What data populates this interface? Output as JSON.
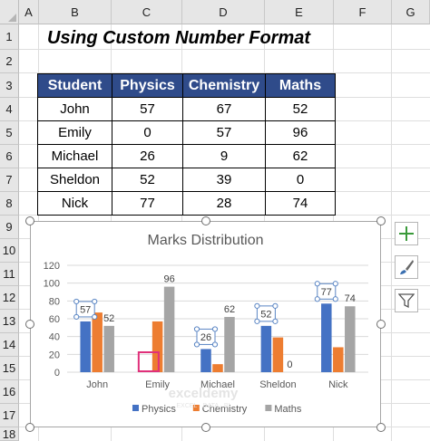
{
  "columns": [
    "A",
    "B",
    "C",
    "D",
    "E",
    "F",
    "G"
  ],
  "rows": [
    "1",
    "2",
    "3",
    "4",
    "5",
    "6",
    "7",
    "8",
    "9",
    "10",
    "11",
    "12",
    "13",
    "14",
    "15",
    "16",
    "17",
    "18"
  ],
  "sheet_title": "Using Custom Number Format",
  "table": {
    "headers": [
      "Student",
      "Physics",
      "Chemistry",
      "Maths"
    ],
    "rows": [
      [
        "John",
        "57",
        "67",
        "52"
      ],
      [
        "Emily",
        "0",
        "57",
        "96"
      ],
      [
        "Michael",
        "26",
        "9",
        "62"
      ],
      [
        "Sheldon",
        "52",
        "39",
        "0"
      ],
      [
        "Nick",
        "77",
        "28",
        "74"
      ]
    ]
  },
  "chart_data": {
    "type": "bar",
    "title": "Marks Distribution",
    "categories": [
      "John",
      "Emily",
      "Michael",
      "Sheldon",
      "Nick"
    ],
    "series": [
      {
        "name": "Physics",
        "values": [
          57,
          0,
          26,
          52,
          77
        ],
        "color": "#4472c4"
      },
      {
        "name": "Chemistry",
        "values": [
          67,
          57,
          9,
          39,
          28
        ],
        "color": "#ed7d31"
      },
      {
        "name": "Maths",
        "values": [
          52,
          96,
          62,
          0,
          74
        ],
        "color": "#a5a5a5"
      }
    ],
    "data_labels": [
      {
        "series": "Physics",
        "category": "John",
        "text": "57",
        "selected": true
      },
      {
        "series": "Physics",
        "category": "Michael",
        "text": "26",
        "selected": true
      },
      {
        "series": "Physics",
        "category": "Sheldon",
        "text": "52",
        "selected": true
      },
      {
        "series": "Physics",
        "category": "Nick",
        "text": "77",
        "selected": true
      },
      {
        "series": "Maths",
        "category": "John",
        "text": "52",
        "selected": false
      },
      {
        "series": "Maths",
        "category": "Emily",
        "text": "96",
        "selected": false
      },
      {
        "series": "Maths",
        "category": "Michael",
        "text": "62",
        "selected": false
      },
      {
        "series": "Maths",
        "category": "Sheldon",
        "text": "0",
        "selected": false
      },
      {
        "series": "Maths",
        "category": "Nick",
        "text": "74",
        "selected": false
      }
    ],
    "yticks": [
      "0",
      "20",
      "40",
      "60",
      "80",
      "100",
      "120"
    ],
    "ylim": [
      0,
      120
    ],
    "grid": true,
    "legend": "bottom",
    "highlight_box_color": "#e0307a"
  },
  "watermark": {
    "brand": "exceldemy",
    "tagline": "EXCEL · DATA · BI"
  },
  "side_buttons": [
    "chart-elements-icon",
    "chart-styles-icon",
    "chart-filters-icon"
  ]
}
